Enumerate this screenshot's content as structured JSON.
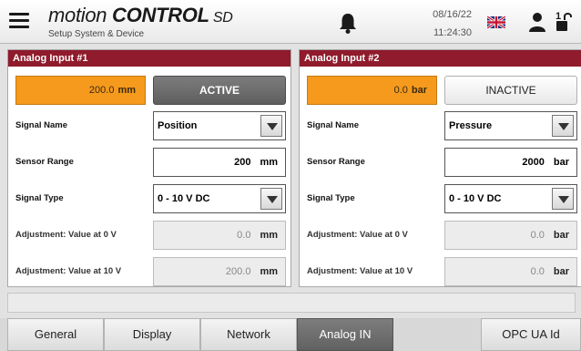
{
  "header": {
    "brand_part1": "motion ",
    "brand_part2": "CONTROL",
    "brand_part3": " SD",
    "subtitle": "Setup System & Device",
    "date": "08/16/22",
    "time": "11:24:30",
    "lock_level": "1",
    "icons": [
      "menu-icon",
      "bell-icon",
      "uk-flag-icon",
      "user-icon",
      "unlock-icon"
    ]
  },
  "inputs": [
    {
      "title": "Analog Input #1",
      "value": "200.0",
      "value_unit": "mm",
      "status": "ACTIVE",
      "signal_name_label": "Signal Name",
      "signal_name": "Position",
      "sensor_range_label": "Sensor Range",
      "sensor_range": "200",
      "sensor_range_unit": "mm",
      "signal_type_label": "Signal Type",
      "signal_type": "0 - 10 V DC",
      "adj0_label": "Adjustment: Value at 0 V",
      "adj0_value": "0.0",
      "adj0_unit": "mm",
      "adj10_label": "Adjustment: Value at 10 V",
      "adj10_value": "200.0",
      "adj10_unit": "mm"
    },
    {
      "title": "Analog Input #2",
      "value": "0.0",
      "value_unit": "bar",
      "status": "INACTIVE",
      "signal_name_label": "Signal Name",
      "signal_name": "Pressure",
      "sensor_range_label": "Sensor Range",
      "sensor_range": "2000",
      "sensor_range_unit": "bar",
      "signal_type_label": "Signal Type",
      "signal_type": "0 - 10 V DC",
      "adj0_label": "Adjustment: Value at 0 V",
      "adj0_value": "0.0",
      "adj0_unit": "bar",
      "adj10_label": "Adjustment: Value at 10 V",
      "adj10_value": "0.0",
      "adj10_unit": "bar"
    }
  ],
  "tabs": [
    {
      "label": "General"
    },
    {
      "label": "Display"
    },
    {
      "label": "Network"
    },
    {
      "label": "Analog IN",
      "selected": true
    },
    {
      "label": "OPC UA Id"
    }
  ],
  "colors": {
    "panel_title": "#8f1b2c",
    "value_box": "#f59a1d",
    "active_button": "#6e6e6e",
    "selected_tab": "#6e6e6e"
  }
}
